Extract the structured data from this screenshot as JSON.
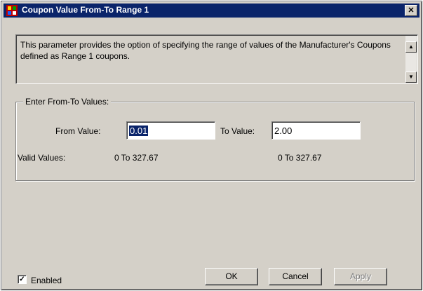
{
  "window": {
    "title": "Coupon Value From-To Range 1",
    "close_glyph": "✕"
  },
  "description": {
    "text": "This parameter provides the option of specifying the range of values of the Manufacturer's Coupons defined as Range 1 coupons.",
    "scroll_up_glyph": "▲",
    "scroll_down_glyph": "▼"
  },
  "group": {
    "label": "Enter From-To Values:",
    "from_label": "From Value:",
    "from_value": "0.01",
    "to_label": "To Value:",
    "to_value": "2.00",
    "valid_label": "Valid Values:",
    "from_valid_range": "0  To  327.67",
    "to_valid_range": "0  To  327.67"
  },
  "enabled": {
    "label": "Enabled",
    "checked": true,
    "check_glyph": "✓"
  },
  "buttons": {
    "ok": "OK",
    "cancel": "Cancel",
    "apply": "Apply"
  }
}
